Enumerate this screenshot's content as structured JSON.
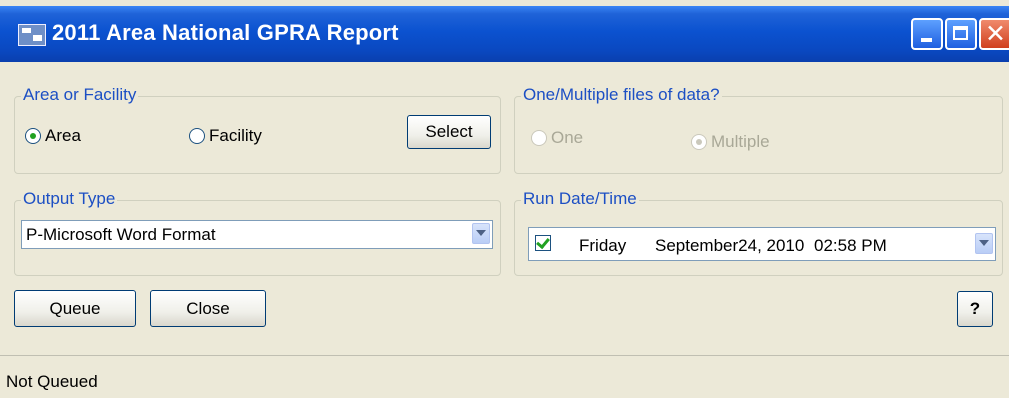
{
  "window": {
    "title": "2011 Area National GPRA Report",
    "icons": {
      "app": "app-icon",
      "minimize": "minimize-icon",
      "maximize": "maximize-icon",
      "close": "close-icon"
    }
  },
  "area_group": {
    "legend": "Area or Facility",
    "options": [
      {
        "label": "Area",
        "checked": true
      },
      {
        "label": "Facility",
        "checked": false
      }
    ],
    "select_button": "Select"
  },
  "files_group": {
    "legend": "One/Multiple files of data?",
    "options": [
      {
        "label": "One",
        "checked": false,
        "disabled": true
      },
      {
        "label": "Multiple",
        "checked": true,
        "disabled": true
      }
    ]
  },
  "output_group": {
    "legend": "Output Type",
    "value": "P-Microsoft Word Format"
  },
  "run_group": {
    "legend": "Run Date/Time",
    "checked": true,
    "day": "Friday",
    "date": "September24, 2010",
    "time": "02:58 PM"
  },
  "buttons": {
    "queue": "Queue",
    "close": "Close",
    "help": "?"
  },
  "status": {
    "text": "Not Queued"
  },
  "colors": {
    "titlebar": "#0a48c0",
    "window_bg": "#ece9d8",
    "legend_text": "#1c4fc4",
    "radio_check": "#21a121"
  }
}
